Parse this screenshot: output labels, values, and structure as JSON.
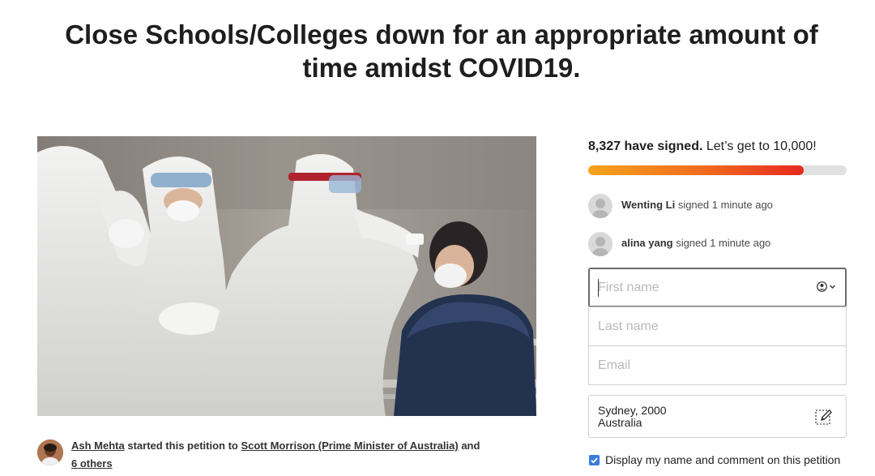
{
  "petition": {
    "title": "Close Schools/Colleges down for an appropriate amount of time amidst COVID19."
  },
  "starter": {
    "name": "Ash Mehta",
    "text_started": " started this petition to ",
    "target": "Scott Morrison (Prime Minister of Australia)",
    "text_and": " and ",
    "others": "6 others"
  },
  "signatures": {
    "count": "8,327 have signed.",
    "goal": " Let’s get to 10,000!",
    "progress_fraction": 0.8327
  },
  "recent_signers": [
    {
      "name": "Wenting Li",
      "action": " signed 1 minute ago"
    },
    {
      "name": "alina yang",
      "action": " signed 1 minute ago"
    }
  ],
  "form": {
    "first_name_placeholder": "First name",
    "last_name_placeholder": "Last name",
    "email_placeholder": "Email",
    "location_line1": "Sydney, 2000",
    "location_line2": "Australia",
    "display_checkbox_label": "Display my name and comment on this petition",
    "display_checked": true
  },
  "colors": {
    "progress_start": "#f7a31c",
    "progress_end": "#e8291f",
    "checkbox": "#3b7ddd"
  }
}
